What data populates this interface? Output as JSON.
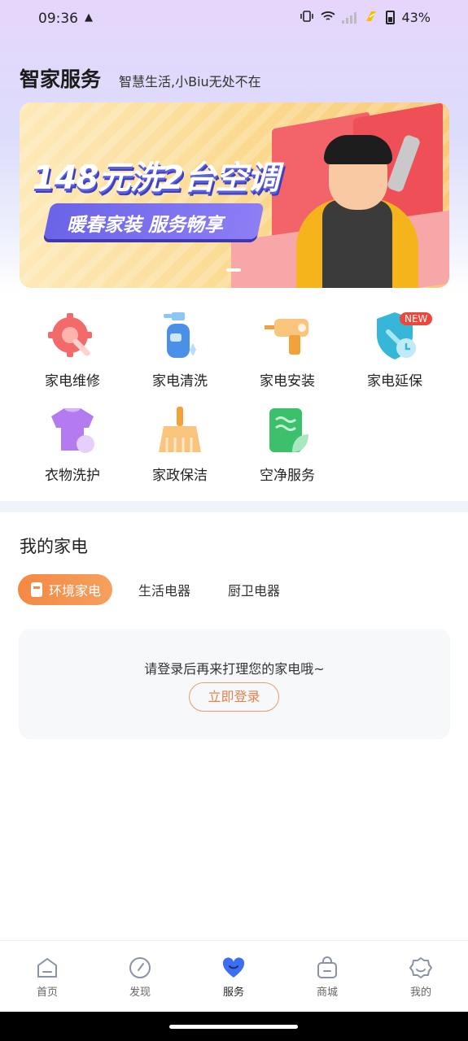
{
  "status_bar": {
    "time": "09:36",
    "battery": "43%"
  },
  "header": {
    "title": "智家服务",
    "subtitle": "智慧生活,小Biu无处不在"
  },
  "banner": {
    "headline": "148元洗2台空调",
    "subheadline": "暖春家装 服务畅享",
    "page_count": 1,
    "active_page": 1
  },
  "services": [
    {
      "label": "家电维修",
      "icon": "repair-gear-icon"
    },
    {
      "label": "家电清洗",
      "icon": "spray-bottle-icon"
    },
    {
      "label": "家电安装",
      "icon": "drill-icon"
    },
    {
      "label": "家电延保",
      "icon": "warranty-shield-icon",
      "badge": "NEW"
    },
    {
      "label": "衣物洗护",
      "icon": "shirt-icon"
    },
    {
      "label": "家政保洁",
      "icon": "broom-icon"
    },
    {
      "label": "空净服务",
      "icon": "air-purifier-icon"
    }
  ],
  "my_appliances": {
    "title": "我的家电",
    "tabs": [
      "环境家电",
      "生活电器",
      "厨卫电器"
    ],
    "active_tab": "环境家电",
    "login_prompt": "请登录后再来打理您的家电哦~",
    "login_button": "立即登录"
  },
  "bottom_nav": [
    {
      "label": "首页",
      "icon": "home-icon"
    },
    {
      "label": "发现",
      "icon": "compass-icon"
    },
    {
      "label": "服务",
      "icon": "heart-icon",
      "active": true
    },
    {
      "label": "商城",
      "icon": "shopping-bag-icon"
    },
    {
      "label": "我的",
      "icon": "profile-icon"
    }
  ],
  "colors": {
    "accent": "#f48843",
    "nav_active": "#3d6df0"
  }
}
